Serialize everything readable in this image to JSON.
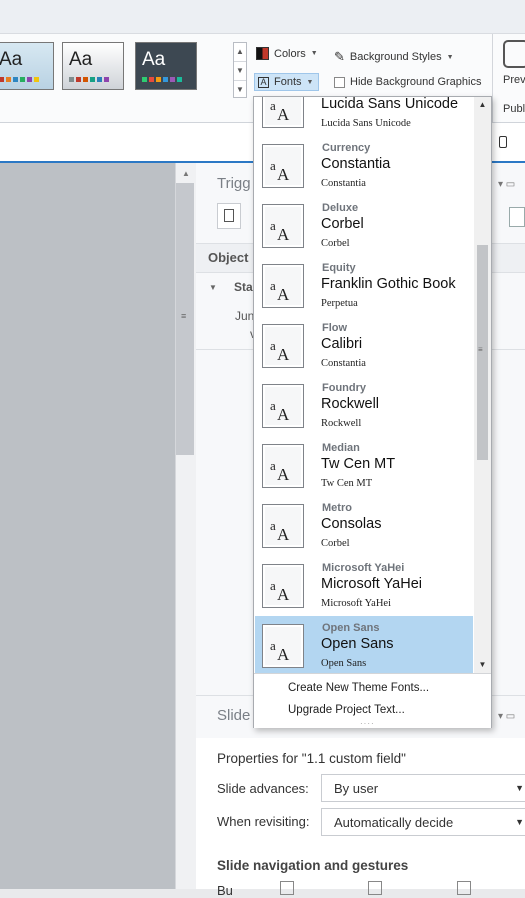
{
  "ribbon": {
    "colors_label": "Colors",
    "fonts_label": "Fonts",
    "background_styles_label": "Background Styles",
    "hide_background_graphics_label": "Hide Background Graphics",
    "preview_label": "Previ",
    "publish_label": "Publi",
    "theme_thumbs": [
      {
        "aa": "Aa"
      },
      {
        "aa": "Aa"
      },
      {
        "aa": "Aa"
      }
    ]
  },
  "triggers_panel": {
    "title": "Trigg",
    "object_label": "Object",
    "state_label": "Sta",
    "row_text_1": "Jun",
    "row_text_2": "v"
  },
  "slide_panel": {
    "title": "Slide",
    "properties_title": "Properties for \"1.1 custom field\"",
    "slide_advances_label": "Slide advances:",
    "slide_advances_value": "By user",
    "when_revisiting_label": "When revisiting:",
    "when_revisiting_value": "Automatically decide",
    "navigation_title": "Slide navigation and gestures",
    "nav_cut_label": "Bu"
  },
  "fonts_dropdown": {
    "items": [
      {
        "theme": "",
        "heading": "Lucida Sans Unicode",
        "body": "Lucida Sans Unicode",
        "selected": false
      },
      {
        "theme": "Currency",
        "heading": "Constantia",
        "body": "Constantia",
        "selected": false
      },
      {
        "theme": "Deluxe",
        "heading": "Corbel",
        "body": "Corbel",
        "selected": false
      },
      {
        "theme": "Equity",
        "heading": "Franklin Gothic Book",
        "body": "Perpetua",
        "selected": false
      },
      {
        "theme": "Flow",
        "heading": "Calibri",
        "body": "Constantia",
        "selected": false
      },
      {
        "theme": "Foundry",
        "heading": "Rockwell",
        "body": "Rockwell",
        "selected": false
      },
      {
        "theme": "Median",
        "heading": "Tw Cen MT",
        "body": "Tw Cen MT",
        "selected": false
      },
      {
        "theme": "Metro",
        "heading": "Consolas",
        "body": "Corbel",
        "selected": false
      },
      {
        "theme": "Microsoft YaHei",
        "heading": "Microsoft YaHei",
        "body": "Microsoft YaHei",
        "selected": false
      },
      {
        "theme": "Open Sans",
        "heading": "Open Sans",
        "body": "Open Sans",
        "selected": true
      }
    ],
    "thumb_text": "A",
    "thumb_text_small": "a",
    "create_new_label": "Create New Theme Fonts...",
    "upgrade_label": "Upgrade Project Text..."
  },
  "colors": {
    "accent_blue": "#2b78c5",
    "selected_bg": "#b3d6f1"
  }
}
